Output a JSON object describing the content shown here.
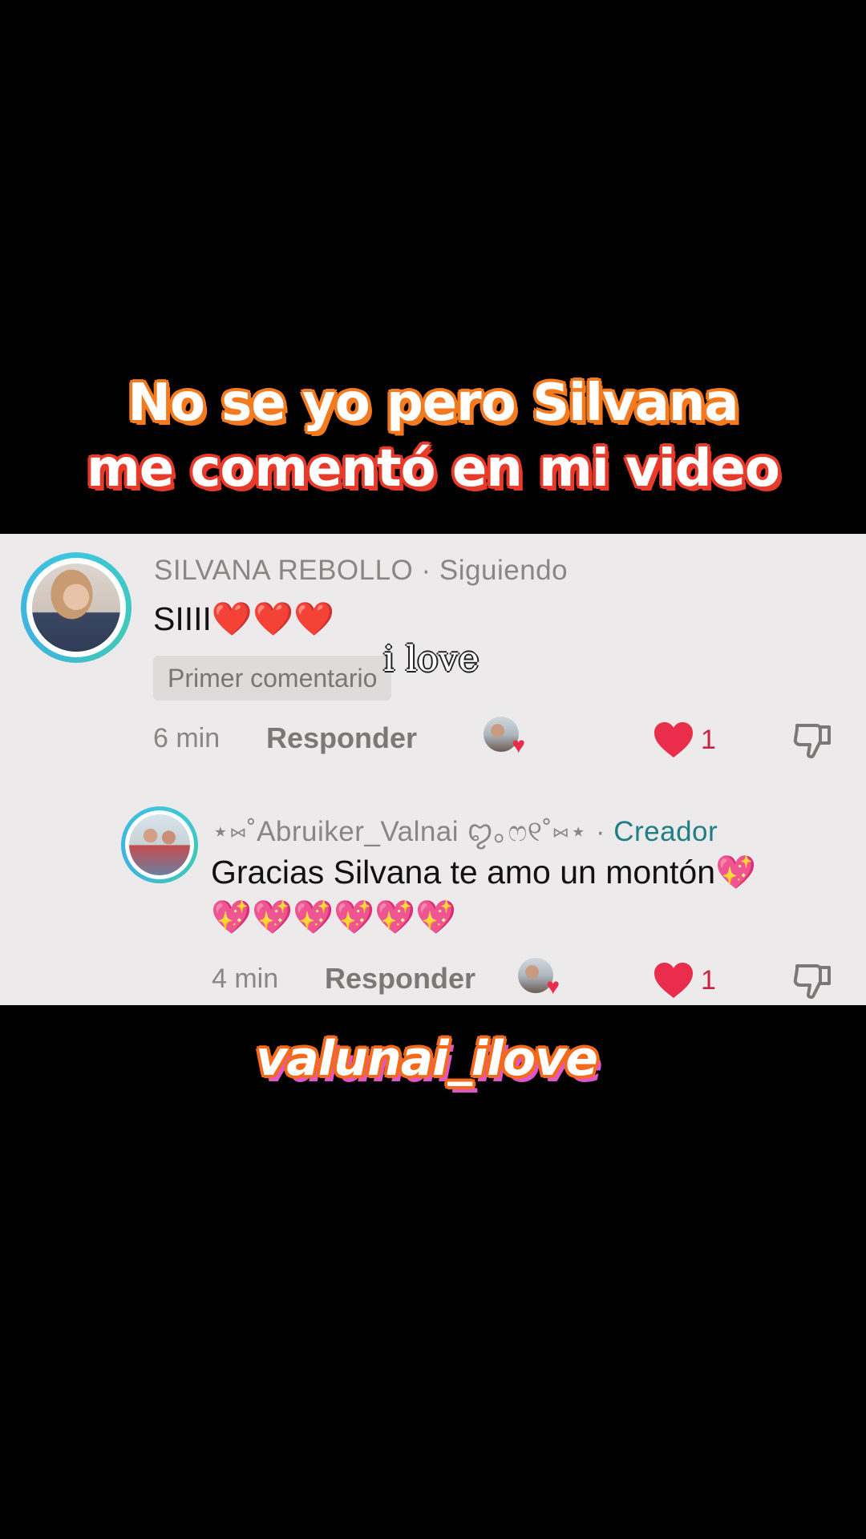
{
  "caption_top": {
    "line1": "No se yo pero Silvana",
    "line2": "me comentó en mi video"
  },
  "caption_bottom": "valunai_ilove",
  "overlay_text": "i love",
  "comment": {
    "username": "SILVANA REBOLLO",
    "separator": "·",
    "relation": "Siguiendo",
    "text": "SIIII❤️❤️❤️",
    "badge": "Primer comentario",
    "time": "6 min",
    "reply_label": "Responder",
    "like_count": "1"
  },
  "reply": {
    "username": "⋆⑅˚Abruiker_Valnai ꨄ｡ෆ୧˚⑅⋆",
    "separator": "·",
    "relation": "Creador",
    "text_line1": "Gracias Silvana te amo un montón💖",
    "text_line2": "💖💖💖💖💖💖",
    "time": "4 min",
    "reply_label": "Responder",
    "like_count": "1"
  },
  "colors": {
    "panel_bg": "#eceaea",
    "like_red": "#ea2d4a",
    "creator_teal": "#1f7f86",
    "ring": "#3fc5de"
  },
  "icons": [
    "heart-icon",
    "dislike-icon",
    "liked-by-creator-avatar"
  ]
}
